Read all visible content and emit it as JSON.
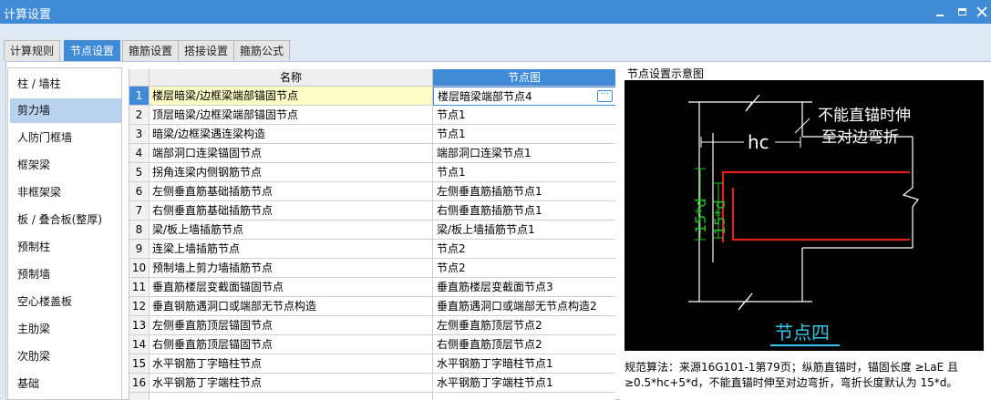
{
  "window": {
    "title": "计算设置"
  },
  "tabs": [
    "计算规则",
    "节点设置",
    "箍筋设置",
    "搭接设置",
    "箍筋公式"
  ],
  "sidebar": {
    "items": [
      "柱 / 墙柱",
      "剪力墙",
      "人防门框墙",
      "框架梁",
      "非框架梁",
      "板 / 叠合板(整厚)",
      "预制柱",
      "预制墙",
      "空心楼盖板",
      "主肋梁",
      "次肋梁",
      "基础"
    ]
  },
  "table": {
    "headers": {
      "name": "名称",
      "node": "节点图"
    },
    "rows": [
      {
        "num": "1",
        "name": "楼层暗梁/边框梁端部锚固节点",
        "node": "楼层暗梁端部节点4"
      },
      {
        "num": "2",
        "name": "顶层暗梁/边框梁端部锚固节点",
        "node": "节点1"
      },
      {
        "num": "3",
        "name": "暗梁/边框梁遇连梁构造",
        "node": "节点1"
      },
      {
        "num": "4",
        "name": "端部洞口连梁锚固节点",
        "node": "端部洞口连梁节点1"
      },
      {
        "num": "5",
        "name": "拐角连梁内侧钢筋节点",
        "node": "节点1"
      },
      {
        "num": "6",
        "name": "左侧垂直筋基础插筋节点",
        "node": "左侧垂直筋插筋节点1"
      },
      {
        "num": "7",
        "name": "右侧垂直筋基础插筋节点",
        "node": "右侧垂直筋插筋节点1"
      },
      {
        "num": "8",
        "name": "梁/板上墙插筋节点",
        "node": "梁/板上墙插筋节点1"
      },
      {
        "num": "9",
        "name": "连梁上墙插筋节点",
        "node": "节点2"
      },
      {
        "num": "10",
        "name": "预制墙上剪力墙插筋节点",
        "node": "节点2"
      },
      {
        "num": "11",
        "name": "垂直筋楼层变截面锚固节点",
        "node": "垂直筋楼层变截面节点3"
      },
      {
        "num": "12",
        "name": "垂直钢筋遇洞口或端部无节点构造",
        "node": "垂直筋遇洞口或端部无节点构造2"
      },
      {
        "num": "13",
        "name": "左侧垂直筋顶层锚固节点",
        "node": "左侧垂直筋顶层节点2"
      },
      {
        "num": "14",
        "name": "右侧垂直筋顶层锚固节点",
        "node": "右侧垂直筋顶层节点2"
      },
      {
        "num": "15",
        "name": "水平钢筋丁字暗柱节点",
        "node": "水平钢筋丁字暗柱节点1"
      },
      {
        "num": "16",
        "name": "水平钢筋丁字端柱节点",
        "node": "水平钢筋丁字端柱节点1"
      }
    ]
  },
  "diagram": {
    "label": "节点设置示意图",
    "text_cannot_anchor_line1": "不能直锚时伸",
    "text_cannot_anchor_line2": "至对边弯折",
    "dim_hc": "hc",
    "dim_15d": "15*d",
    "caption": "节点四",
    "colors": {
      "structure": "#ffffff",
      "rebar": "#e0201b",
      "dimension": "#25c025",
      "caption": "#34c6e6"
    }
  },
  "note": "规范算法：来源16G101-1第79页；纵筋直锚时，锚固长度 ≥LaE 且≥0.5*hc+5*d，不能直锚时伸至对边弯折，弯折长度默认为 15*d。",
  "colors": {
    "accent": "#3f8bd8",
    "selection_bg": "#b9d3ee",
    "highlight_cell": "#fdfbc6"
  }
}
